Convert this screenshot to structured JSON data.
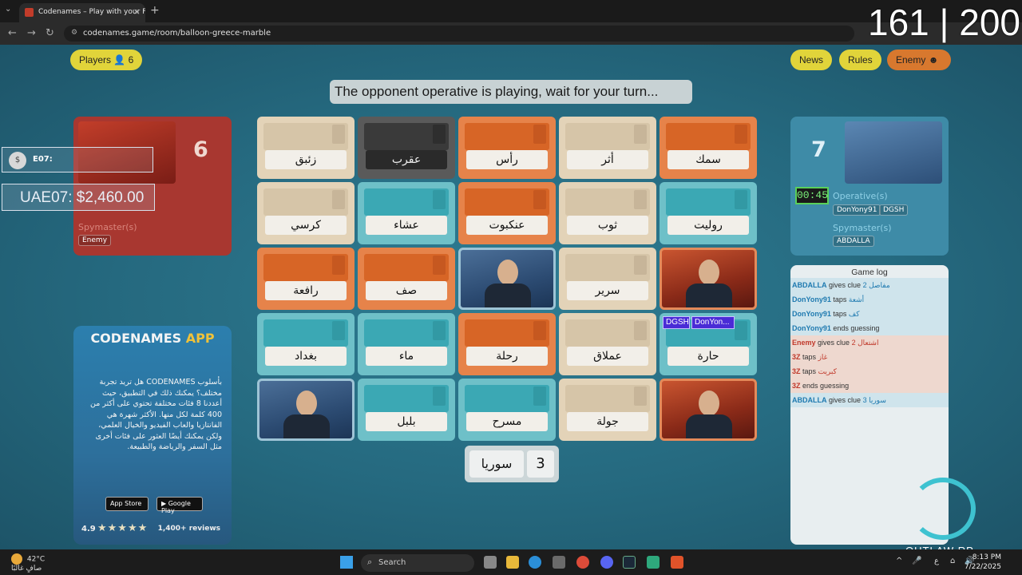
{
  "browser": {
    "tab_title": "Codenames – Play with your Fr",
    "url": "codenames.game/room/balloon-greece-marble"
  },
  "overlay_counter": "161 | 200",
  "header": {
    "players_label": "Players",
    "players_count": "6",
    "news_label": "News",
    "rules_label": "Rules",
    "enemy_label": "Enemy"
  },
  "status_message": "The opponent operative is playing, wait for your turn...",
  "red_team": {
    "remaining": "6",
    "spymaster_label": "Spymaster(s)",
    "spymaster": "Enemy"
  },
  "hud": {
    "line1": "E07:",
    "line2": "UAE07: $2,460.00"
  },
  "ad": {
    "title": "CODENAMES",
    "title_accent": "APP",
    "body": "بأسلوب CODENAMES هل تريد تجربة مختلف؟ يمكنك ذلك في التطبيق، حيث أعددنا 8 فئات مختلفة تحتوي على أكثر من 400 كلمة لكل منها. الأكثر شهرة هي الفانتازيا والعاب الفيديو والخيال العلمي، ولكن يمكنك أيضًا العثور على فئات أخرى مثل السفر والرياضة والطبيعة.",
    "app_store": "App Store",
    "google_play": "Google Play",
    "rating": "4.9",
    "stars": "★★★★★",
    "reviews": "1,400+ reviews"
  },
  "board": {
    "rows": [
      [
        {
          "word": "زئبق",
          "color": "neutral"
        },
        {
          "word": "عقرب",
          "color": "black"
        },
        {
          "word": "رأس",
          "color": "red"
        },
        {
          "word": "أثر",
          "color": "neutral"
        },
        {
          "word": "سمك",
          "color": "red"
        }
      ],
      [
        {
          "word": "كرسي",
          "color": "neutral"
        },
        {
          "word": "عشاء",
          "color": "blue"
        },
        {
          "word": "عنكبوت",
          "color": "red"
        },
        {
          "word": "ثوب",
          "color": "neutral"
        },
        {
          "word": "روليت",
          "color": "blue"
        }
      ],
      [
        {
          "word": "رافعة",
          "color": "red"
        },
        {
          "word": "صف",
          "color": "red"
        },
        {
          "word": "",
          "color": "agent-blue"
        },
        {
          "word": "سرير",
          "color": "neutral"
        },
        {
          "word": "",
          "color": "agent-red"
        }
      ],
      [
        {
          "word": "بغداد",
          "color": "blue"
        },
        {
          "word": "ماء",
          "color": "blue"
        },
        {
          "word": "رحلة",
          "color": "red"
        },
        {
          "word": "عملاق",
          "color": "neutral"
        },
        {
          "word": "حارة",
          "color": "blue"
        }
      ],
      [
        {
          "word": "",
          "color": "agent-blue"
        },
        {
          "word": "بلبل",
          "color": "blue"
        },
        {
          "word": "مسرح",
          "color": "blue"
        },
        {
          "word": "جولة",
          "color": "neutral"
        },
        {
          "word": "",
          "color": "agent-red"
        }
      ]
    ],
    "vote_tags": [
      "DGSH",
      "DonYon..."
    ]
  },
  "current_clue": {
    "word": "سوريا",
    "number": "3"
  },
  "blue_team": {
    "remaining": "7",
    "timer": "00:45",
    "operatives_label": "Operative(s)",
    "operatives": [
      "DonYony91",
      "DGSH"
    ],
    "spymaster_label": "Spymaster(s)",
    "spymaster": "ABDALLA"
  },
  "game_log": {
    "title": "Game log",
    "entries": [
      {
        "player": "ABDALLA",
        "action": "gives clue",
        "detail": "مفاصل 2",
        "team": "blue"
      },
      {
        "player": "DonYony91",
        "action": "taps",
        "detail": "أشعة",
        "team": "blue"
      },
      {
        "player": "DonYony91",
        "action": "taps",
        "detail": "كف",
        "team": "blue"
      },
      {
        "player": "DonYony91",
        "action": "ends guessing",
        "detail": "",
        "team": "blue"
      },
      {
        "player": "Enemy",
        "action": "gives clue",
        "detail": "اشتعال 2",
        "team": "red"
      },
      {
        "player": "3Z",
        "action": "taps",
        "detail": "غاز",
        "team": "red"
      },
      {
        "player": "3Z",
        "action": "taps",
        "detail": "كبريت",
        "team": "red"
      },
      {
        "player": "3Z",
        "action": "ends guessing",
        "detail": "",
        "team": "red"
      },
      {
        "player": "ABDALLA",
        "action": "gives clue",
        "detail": "سوريا 3",
        "team": "blue"
      }
    ]
  },
  "watermark": "OUTLAW RP",
  "taskbar": {
    "temp": "42°C",
    "weather": "صافٍ غالبًا",
    "search_placeholder": "Search",
    "time": "8:13 PM",
    "date": "7/22/2025"
  },
  "colors": {
    "red_team": "#a83730",
    "blue_team": "#3e8ba7",
    "accent_yellow": "#e1d43a",
    "enemy_orange": "#d8782e"
  }
}
